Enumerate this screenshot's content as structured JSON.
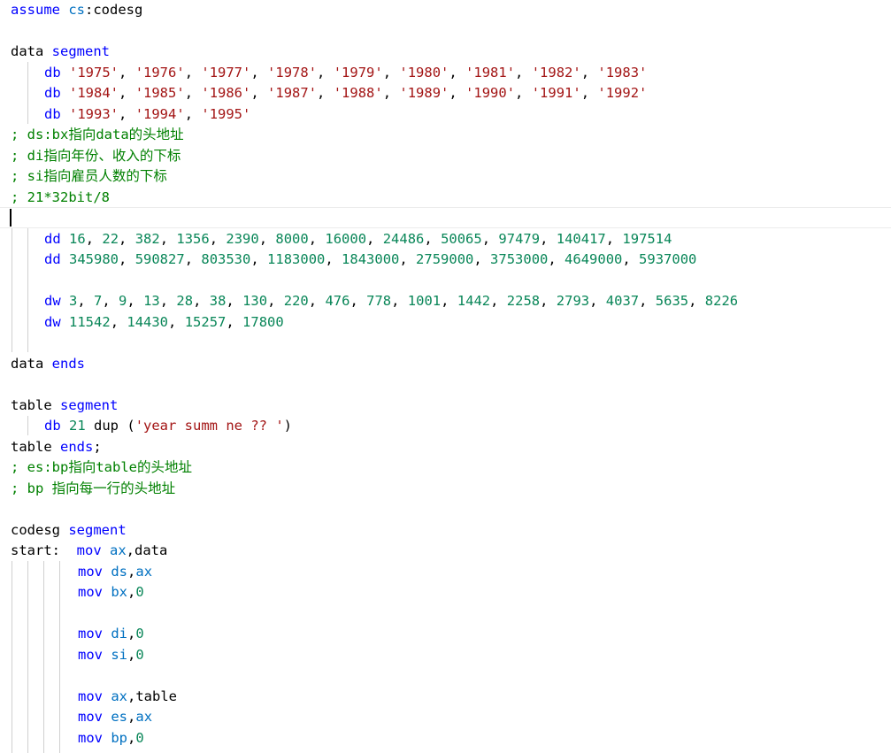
{
  "lines": [
    {
      "y": 0,
      "indent": 0,
      "tokens": [
        {
          "t": "assume",
          "c": "kw"
        },
        {
          "t": " ",
          "c": "pl"
        },
        {
          "t": "cs",
          "c": "reg"
        },
        {
          "t": ":codesg",
          "c": "pl"
        }
      ]
    },
    {
      "y": 2,
      "indent": 0,
      "tokens": [
        {
          "t": "data",
          "c": "pl"
        },
        {
          "t": " ",
          "c": "pl"
        },
        {
          "t": "segment",
          "c": "kw"
        }
      ]
    },
    {
      "y": 3,
      "indent": 1,
      "tokens": [
        {
          "t": "db",
          "c": "kw"
        },
        {
          "t": " ",
          "c": "pl"
        },
        {
          "t": "'1975'",
          "c": "str"
        },
        {
          "t": ", ",
          "c": "pl"
        },
        {
          "t": "'1976'",
          "c": "str"
        },
        {
          "t": ", ",
          "c": "pl"
        },
        {
          "t": "'1977'",
          "c": "str"
        },
        {
          "t": ", ",
          "c": "pl"
        },
        {
          "t": "'1978'",
          "c": "str"
        },
        {
          "t": ", ",
          "c": "pl"
        },
        {
          "t": "'1979'",
          "c": "str"
        },
        {
          "t": ", ",
          "c": "pl"
        },
        {
          "t": "'1980'",
          "c": "str"
        },
        {
          "t": ", ",
          "c": "pl"
        },
        {
          "t": "'1981'",
          "c": "str"
        },
        {
          "t": ", ",
          "c": "pl"
        },
        {
          "t": "'1982'",
          "c": "str"
        },
        {
          "t": ", ",
          "c": "pl"
        },
        {
          "t": "'1983'",
          "c": "str"
        }
      ]
    },
    {
      "y": 4,
      "indent": 1,
      "tokens": [
        {
          "t": "db",
          "c": "kw"
        },
        {
          "t": " ",
          "c": "pl"
        },
        {
          "t": "'1984'",
          "c": "str"
        },
        {
          "t": ", ",
          "c": "pl"
        },
        {
          "t": "'1985'",
          "c": "str"
        },
        {
          "t": ", ",
          "c": "pl"
        },
        {
          "t": "'1986'",
          "c": "str"
        },
        {
          "t": ", ",
          "c": "pl"
        },
        {
          "t": "'1987'",
          "c": "str"
        },
        {
          "t": ", ",
          "c": "pl"
        },
        {
          "t": "'1988'",
          "c": "str"
        },
        {
          "t": ", ",
          "c": "pl"
        },
        {
          "t": "'1989'",
          "c": "str"
        },
        {
          "t": ", ",
          "c": "pl"
        },
        {
          "t": "'1990'",
          "c": "str"
        },
        {
          "t": ", ",
          "c": "pl"
        },
        {
          "t": "'1991'",
          "c": "str"
        },
        {
          "t": ", ",
          "c": "pl"
        },
        {
          "t": "'1992'",
          "c": "str"
        }
      ]
    },
    {
      "y": 5,
      "indent": 1,
      "tokens": [
        {
          "t": "db",
          "c": "kw"
        },
        {
          "t": " ",
          "c": "pl"
        },
        {
          "t": "'1993'",
          "c": "str"
        },
        {
          "t": ", ",
          "c": "pl"
        },
        {
          "t": "'1994'",
          "c": "str"
        },
        {
          "t": ", ",
          "c": "pl"
        },
        {
          "t": "'1995'",
          "c": "str"
        }
      ]
    },
    {
      "y": 6,
      "indent": 0,
      "tokens": [
        {
          "t": "; ds:bx指向data的头地址",
          "c": "cm"
        }
      ]
    },
    {
      "y": 7,
      "indent": 0,
      "tokens": [
        {
          "t": "; di指向年份、收入的下标",
          "c": "cm"
        }
      ]
    },
    {
      "y": 8,
      "indent": 0,
      "tokens": [
        {
          "t": "; si指向雇员人数的下标",
          "c": "cm"
        }
      ]
    },
    {
      "y": 9,
      "indent": 0,
      "tokens": [
        {
          "t": "; 21*32bit/8",
          "c": "cm"
        }
      ]
    },
    {
      "y": 11,
      "indent": 1,
      "tokens": [
        {
          "t": "dd",
          "c": "kw"
        },
        {
          "t": " ",
          "c": "pl"
        },
        {
          "t": "16",
          "c": "num"
        },
        {
          "t": ", ",
          "c": "pl"
        },
        {
          "t": "22",
          "c": "num"
        },
        {
          "t": ", ",
          "c": "pl"
        },
        {
          "t": "382",
          "c": "num"
        },
        {
          "t": ", ",
          "c": "pl"
        },
        {
          "t": "1356",
          "c": "num"
        },
        {
          "t": ", ",
          "c": "pl"
        },
        {
          "t": "2390",
          "c": "num"
        },
        {
          "t": ", ",
          "c": "pl"
        },
        {
          "t": "8000",
          "c": "num"
        },
        {
          "t": ", ",
          "c": "pl"
        },
        {
          "t": "16000",
          "c": "num"
        },
        {
          "t": ", ",
          "c": "pl"
        },
        {
          "t": "24486",
          "c": "num"
        },
        {
          "t": ", ",
          "c": "pl"
        },
        {
          "t": "50065",
          "c": "num"
        },
        {
          "t": ", ",
          "c": "pl"
        },
        {
          "t": "97479",
          "c": "num"
        },
        {
          "t": ", ",
          "c": "pl"
        },
        {
          "t": "140417",
          "c": "num"
        },
        {
          "t": ", ",
          "c": "pl"
        },
        {
          "t": "197514",
          "c": "num"
        }
      ]
    },
    {
      "y": 12,
      "indent": 1,
      "tokens": [
        {
          "t": "dd",
          "c": "kw"
        },
        {
          "t": " ",
          "c": "pl"
        },
        {
          "t": "345980",
          "c": "num"
        },
        {
          "t": ", ",
          "c": "pl"
        },
        {
          "t": "590827",
          "c": "num"
        },
        {
          "t": ", ",
          "c": "pl"
        },
        {
          "t": "803530",
          "c": "num"
        },
        {
          "t": ", ",
          "c": "pl"
        },
        {
          "t": "1183000",
          "c": "num"
        },
        {
          "t": ", ",
          "c": "pl"
        },
        {
          "t": "1843000",
          "c": "num"
        },
        {
          "t": ", ",
          "c": "pl"
        },
        {
          "t": "2759000",
          "c": "num"
        },
        {
          "t": ", ",
          "c": "pl"
        },
        {
          "t": "3753000",
          "c": "num"
        },
        {
          "t": ", ",
          "c": "pl"
        },
        {
          "t": "4649000",
          "c": "num"
        },
        {
          "t": ", ",
          "c": "pl"
        },
        {
          "t": "5937000",
          "c": "num"
        }
      ]
    },
    {
      "y": 14,
      "indent": 1,
      "tokens": [
        {
          "t": "dw",
          "c": "kw"
        },
        {
          "t": " ",
          "c": "pl"
        },
        {
          "t": "3",
          "c": "num"
        },
        {
          "t": ", ",
          "c": "pl"
        },
        {
          "t": "7",
          "c": "num"
        },
        {
          "t": ", ",
          "c": "pl"
        },
        {
          "t": "9",
          "c": "num"
        },
        {
          "t": ", ",
          "c": "pl"
        },
        {
          "t": "13",
          "c": "num"
        },
        {
          "t": ", ",
          "c": "pl"
        },
        {
          "t": "28",
          "c": "num"
        },
        {
          "t": ", ",
          "c": "pl"
        },
        {
          "t": "38",
          "c": "num"
        },
        {
          "t": ", ",
          "c": "pl"
        },
        {
          "t": "130",
          "c": "num"
        },
        {
          "t": ", ",
          "c": "pl"
        },
        {
          "t": "220",
          "c": "num"
        },
        {
          "t": ", ",
          "c": "pl"
        },
        {
          "t": "476",
          "c": "num"
        },
        {
          "t": ", ",
          "c": "pl"
        },
        {
          "t": "778",
          "c": "num"
        },
        {
          "t": ", ",
          "c": "pl"
        },
        {
          "t": "1001",
          "c": "num"
        },
        {
          "t": ", ",
          "c": "pl"
        },
        {
          "t": "1442",
          "c": "num"
        },
        {
          "t": ", ",
          "c": "pl"
        },
        {
          "t": "2258",
          "c": "num"
        },
        {
          "t": ", ",
          "c": "pl"
        },
        {
          "t": "2793",
          "c": "num"
        },
        {
          "t": ", ",
          "c": "pl"
        },
        {
          "t": "4037",
          "c": "num"
        },
        {
          "t": ", ",
          "c": "pl"
        },
        {
          "t": "5635",
          "c": "num"
        },
        {
          "t": ", ",
          "c": "pl"
        },
        {
          "t": "8226",
          "c": "num"
        }
      ]
    },
    {
      "y": 15,
      "indent": 1,
      "tokens": [
        {
          "t": "dw",
          "c": "kw"
        },
        {
          "t": " ",
          "c": "pl"
        },
        {
          "t": "11542",
          "c": "num"
        },
        {
          "t": ", ",
          "c": "pl"
        },
        {
          "t": "14430",
          "c": "num"
        },
        {
          "t": ", ",
          "c": "pl"
        },
        {
          "t": "15257",
          "c": "num"
        },
        {
          "t": ", ",
          "c": "pl"
        },
        {
          "t": "17800",
          "c": "num"
        }
      ]
    },
    {
      "y": 17,
      "indent": 0,
      "tokens": [
        {
          "t": "data",
          "c": "pl"
        },
        {
          "t": " ",
          "c": "pl"
        },
        {
          "t": "ends",
          "c": "kw"
        }
      ]
    },
    {
      "y": 19,
      "indent": 0,
      "tokens": [
        {
          "t": "table",
          "c": "pl"
        },
        {
          "t": " ",
          "c": "pl"
        },
        {
          "t": "segment",
          "c": "kw"
        }
      ]
    },
    {
      "y": 20,
      "indent": 1,
      "tokens": [
        {
          "t": "db",
          "c": "kw"
        },
        {
          "t": " ",
          "c": "pl"
        },
        {
          "t": "21",
          "c": "num"
        },
        {
          "t": " dup (",
          "c": "pl"
        },
        {
          "t": "'year summ ne ?? '",
          "c": "str"
        },
        {
          "t": ")",
          "c": "pl"
        }
      ]
    },
    {
      "y": 21,
      "indent": 0,
      "tokens": [
        {
          "t": "table",
          "c": "pl"
        },
        {
          "t": " ",
          "c": "pl"
        },
        {
          "t": "ends",
          "c": "kw"
        },
        {
          "t": ";",
          "c": "pl"
        }
      ]
    },
    {
      "y": 22,
      "indent": 0,
      "tokens": [
        {
          "t": "; es:bp指向table的头地址",
          "c": "cm"
        }
      ]
    },
    {
      "y": 23,
      "indent": 0,
      "tokens": [
        {
          "t": "; bp 指向每一行的头地址",
          "c": "cm"
        }
      ]
    },
    {
      "y": 25,
      "indent": 0,
      "tokens": [
        {
          "t": "codesg",
          "c": "pl"
        },
        {
          "t": " ",
          "c": "pl"
        },
        {
          "t": "segment",
          "c": "kw"
        }
      ]
    },
    {
      "y": 26,
      "indent": 0,
      "tokens": [
        {
          "t": "start:  ",
          "c": "pl"
        },
        {
          "t": "mov",
          "c": "kw"
        },
        {
          "t": " ",
          "c": "pl"
        },
        {
          "t": "ax",
          "c": "reg"
        },
        {
          "t": ",data",
          "c": "pl"
        }
      ]
    },
    {
      "y": 27,
      "indent": 2,
      "tokens": [
        {
          "t": "mov",
          "c": "kw"
        },
        {
          "t": " ",
          "c": "pl"
        },
        {
          "t": "ds",
          "c": "reg"
        },
        {
          "t": ",",
          "c": "pl"
        },
        {
          "t": "ax",
          "c": "reg"
        }
      ]
    },
    {
      "y": 28,
      "indent": 2,
      "tokens": [
        {
          "t": "mov",
          "c": "kw"
        },
        {
          "t": " ",
          "c": "pl"
        },
        {
          "t": "bx",
          "c": "reg"
        },
        {
          "t": ",",
          "c": "pl"
        },
        {
          "t": "0",
          "c": "num"
        }
      ]
    },
    {
      "y": 30,
      "indent": 2,
      "tokens": [
        {
          "t": "mov",
          "c": "kw"
        },
        {
          "t": " ",
          "c": "pl"
        },
        {
          "t": "di",
          "c": "reg"
        },
        {
          "t": ",",
          "c": "pl"
        },
        {
          "t": "0",
          "c": "num"
        }
      ]
    },
    {
      "y": 31,
      "indent": 2,
      "tokens": [
        {
          "t": "mov",
          "c": "kw"
        },
        {
          "t": " ",
          "c": "pl"
        },
        {
          "t": "si",
          "c": "reg"
        },
        {
          "t": ",",
          "c": "pl"
        },
        {
          "t": "0",
          "c": "num"
        }
      ]
    },
    {
      "y": 33,
      "indent": 2,
      "tokens": [
        {
          "t": "mov",
          "c": "kw"
        },
        {
          "t": " ",
          "c": "pl"
        },
        {
          "t": "ax",
          "c": "reg"
        },
        {
          "t": ",table",
          "c": "pl"
        }
      ]
    },
    {
      "y": 34,
      "indent": 2,
      "tokens": [
        {
          "t": "mov",
          "c": "kw"
        },
        {
          "t": " ",
          "c": "pl"
        },
        {
          "t": "es",
          "c": "reg"
        },
        {
          "t": ",",
          "c": "pl"
        },
        {
          "t": "ax",
          "c": "reg"
        }
      ]
    },
    {
      "y": 35,
      "indent": 2,
      "tokens": [
        {
          "t": "mov",
          "c": "kw"
        },
        {
          "t": " ",
          "c": "pl"
        },
        {
          "t": "bp",
          "c": "reg"
        },
        {
          "t": ",",
          "c": "pl"
        },
        {
          "t": "0",
          "c": "num"
        }
      ]
    }
  ]
}
